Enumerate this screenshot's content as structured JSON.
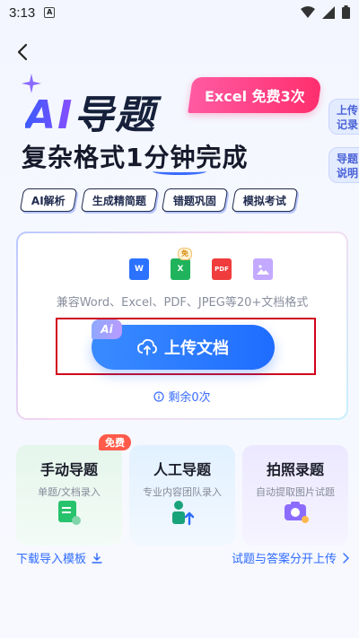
{
  "status": {
    "time": "3:13",
    "notification": "A"
  },
  "hero": {
    "ai_text": "AI",
    "title_rest": "导题",
    "subtitle": "复杂格式1分钟完成",
    "excel_badge": "Excel 免费3次"
  },
  "side_tabs": [
    {
      "line1": "上传",
      "line2": "记录"
    },
    {
      "line1": "导题",
      "line2": "说明"
    }
  ],
  "features": [
    "AI解析",
    "生成精简题",
    "错题巩固",
    "模拟考试"
  ],
  "upload": {
    "file_types": [
      "W",
      "X",
      "PDF",
      "IMG"
    ],
    "free_label": "免",
    "compat": "兼容Word、Excel、PDF、JPEG等20+文档格式",
    "ai_mini": "Ai",
    "button": "上传文档",
    "remaining": "剩余0次"
  },
  "modes": [
    {
      "title": "手动导题",
      "desc": "单题/文档录入",
      "badge": "免费"
    },
    {
      "title": "人工导题",
      "desc": "专业内容团队录入"
    },
    {
      "title": "拍照录题",
      "desc": "自动提取图片试题"
    }
  ],
  "links": {
    "download": "下载导入模板",
    "separate": "试题与答案分开上传"
  },
  "colors": {
    "primary": "#1f6dff",
    "badge": "#ff2e6e"
  }
}
